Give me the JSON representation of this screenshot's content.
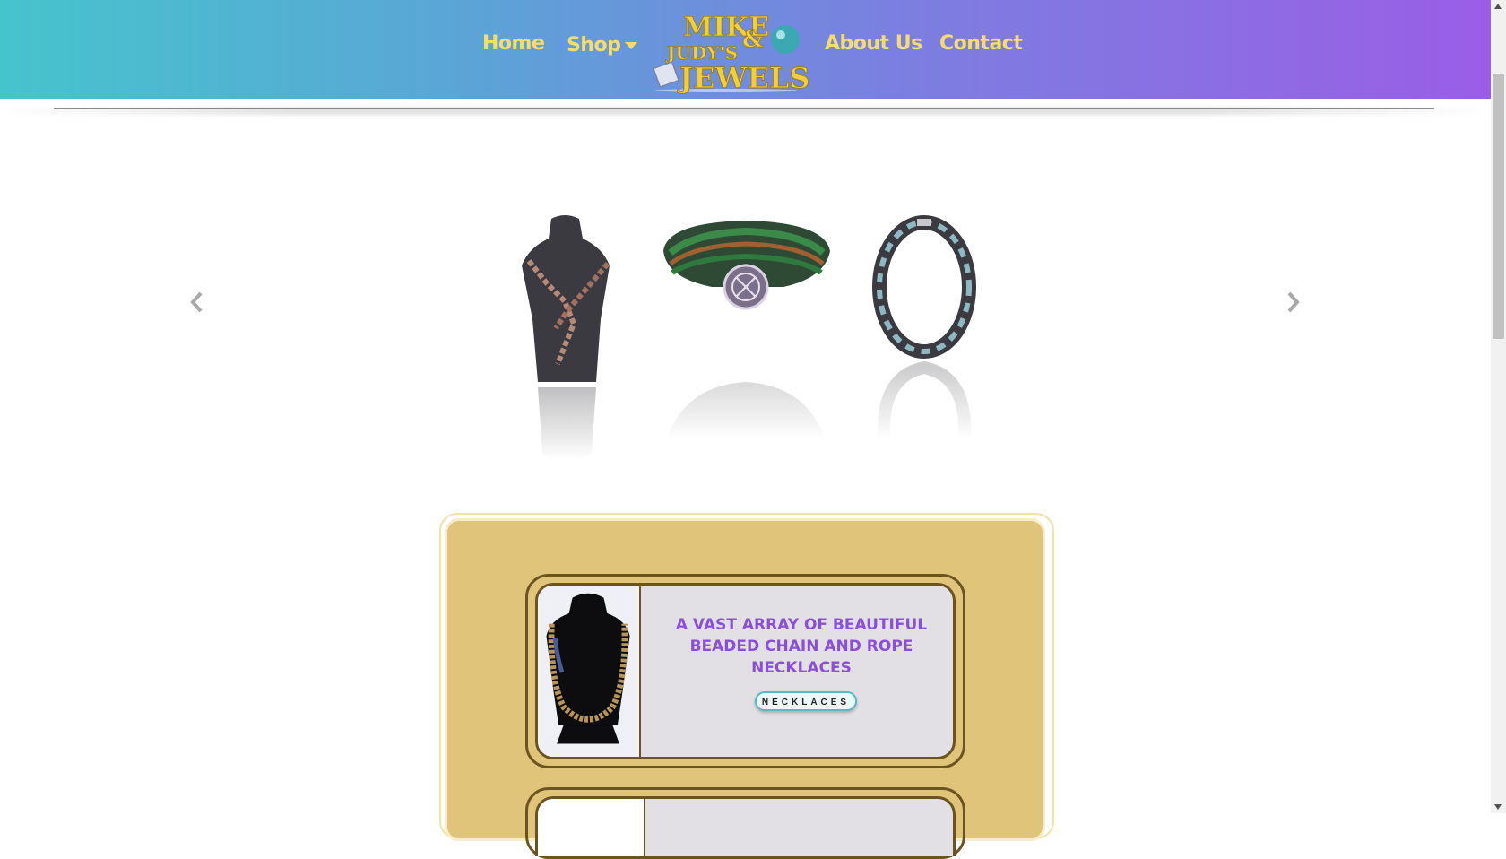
{
  "nav": {
    "home": "Home",
    "shop": "Shop",
    "about": "About Us",
    "contact": "Contact"
  },
  "logo": {
    "text_line1": "MIKE",
    "text_amp": "&",
    "text_line2": "JUDY'S",
    "text_line3": "JEWELS"
  },
  "carousel": {
    "items": [
      {
        "name": "copper-chain-necklace-on-bust"
      },
      {
        "name": "green-beaded-bracelet-celtic-clasp"
      },
      {
        "name": "black-white-beaded-necklace"
      }
    ]
  },
  "feature": {
    "title": "A VAST ARRAY OF BEAUTIFUL BEADED CHAIN AND ROPE NECKLACES",
    "button": "NECKLACES"
  },
  "colors": {
    "header_start": "#46c4cc",
    "header_end": "#9a5ee6",
    "nav_text": "#f4dd6a",
    "panel": "#dfc47a",
    "card_border": "#6b5420",
    "card_bg": "#e2e0e4",
    "title": "#8a4fd8",
    "pill_border": "#58b8c6"
  }
}
